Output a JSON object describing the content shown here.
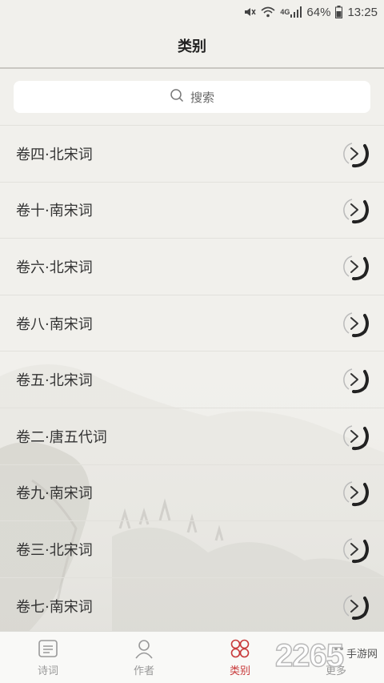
{
  "status": {
    "network": "4G",
    "battery": "64%",
    "time": "13:25"
  },
  "header": {
    "title": "类别"
  },
  "search": {
    "placeholder": "搜索"
  },
  "categories": [
    {
      "label": "卷四·北宋词"
    },
    {
      "label": "卷十·南宋词"
    },
    {
      "label": "卷六·北宋词"
    },
    {
      "label": "卷八·南宋词"
    },
    {
      "label": "卷五·北宋词"
    },
    {
      "label": "卷二·唐五代词"
    },
    {
      "label": "卷九·南宋词"
    },
    {
      "label": "卷三·北宋词"
    },
    {
      "label": "卷七·南宋词"
    }
  ],
  "tabs": [
    {
      "label": "诗词",
      "icon": "poem-icon",
      "active": false
    },
    {
      "label": "作者",
      "icon": "person-icon",
      "active": false
    },
    {
      "label": "类别",
      "icon": "category-icon",
      "active": true
    },
    {
      "label": "更多",
      "icon": "more-icon",
      "active": false
    }
  ],
  "watermark": {
    "brand": "2265",
    "suffix": "手游网"
  },
  "colors": {
    "accent": "#c8393a",
    "background": "#f1f0ec"
  }
}
